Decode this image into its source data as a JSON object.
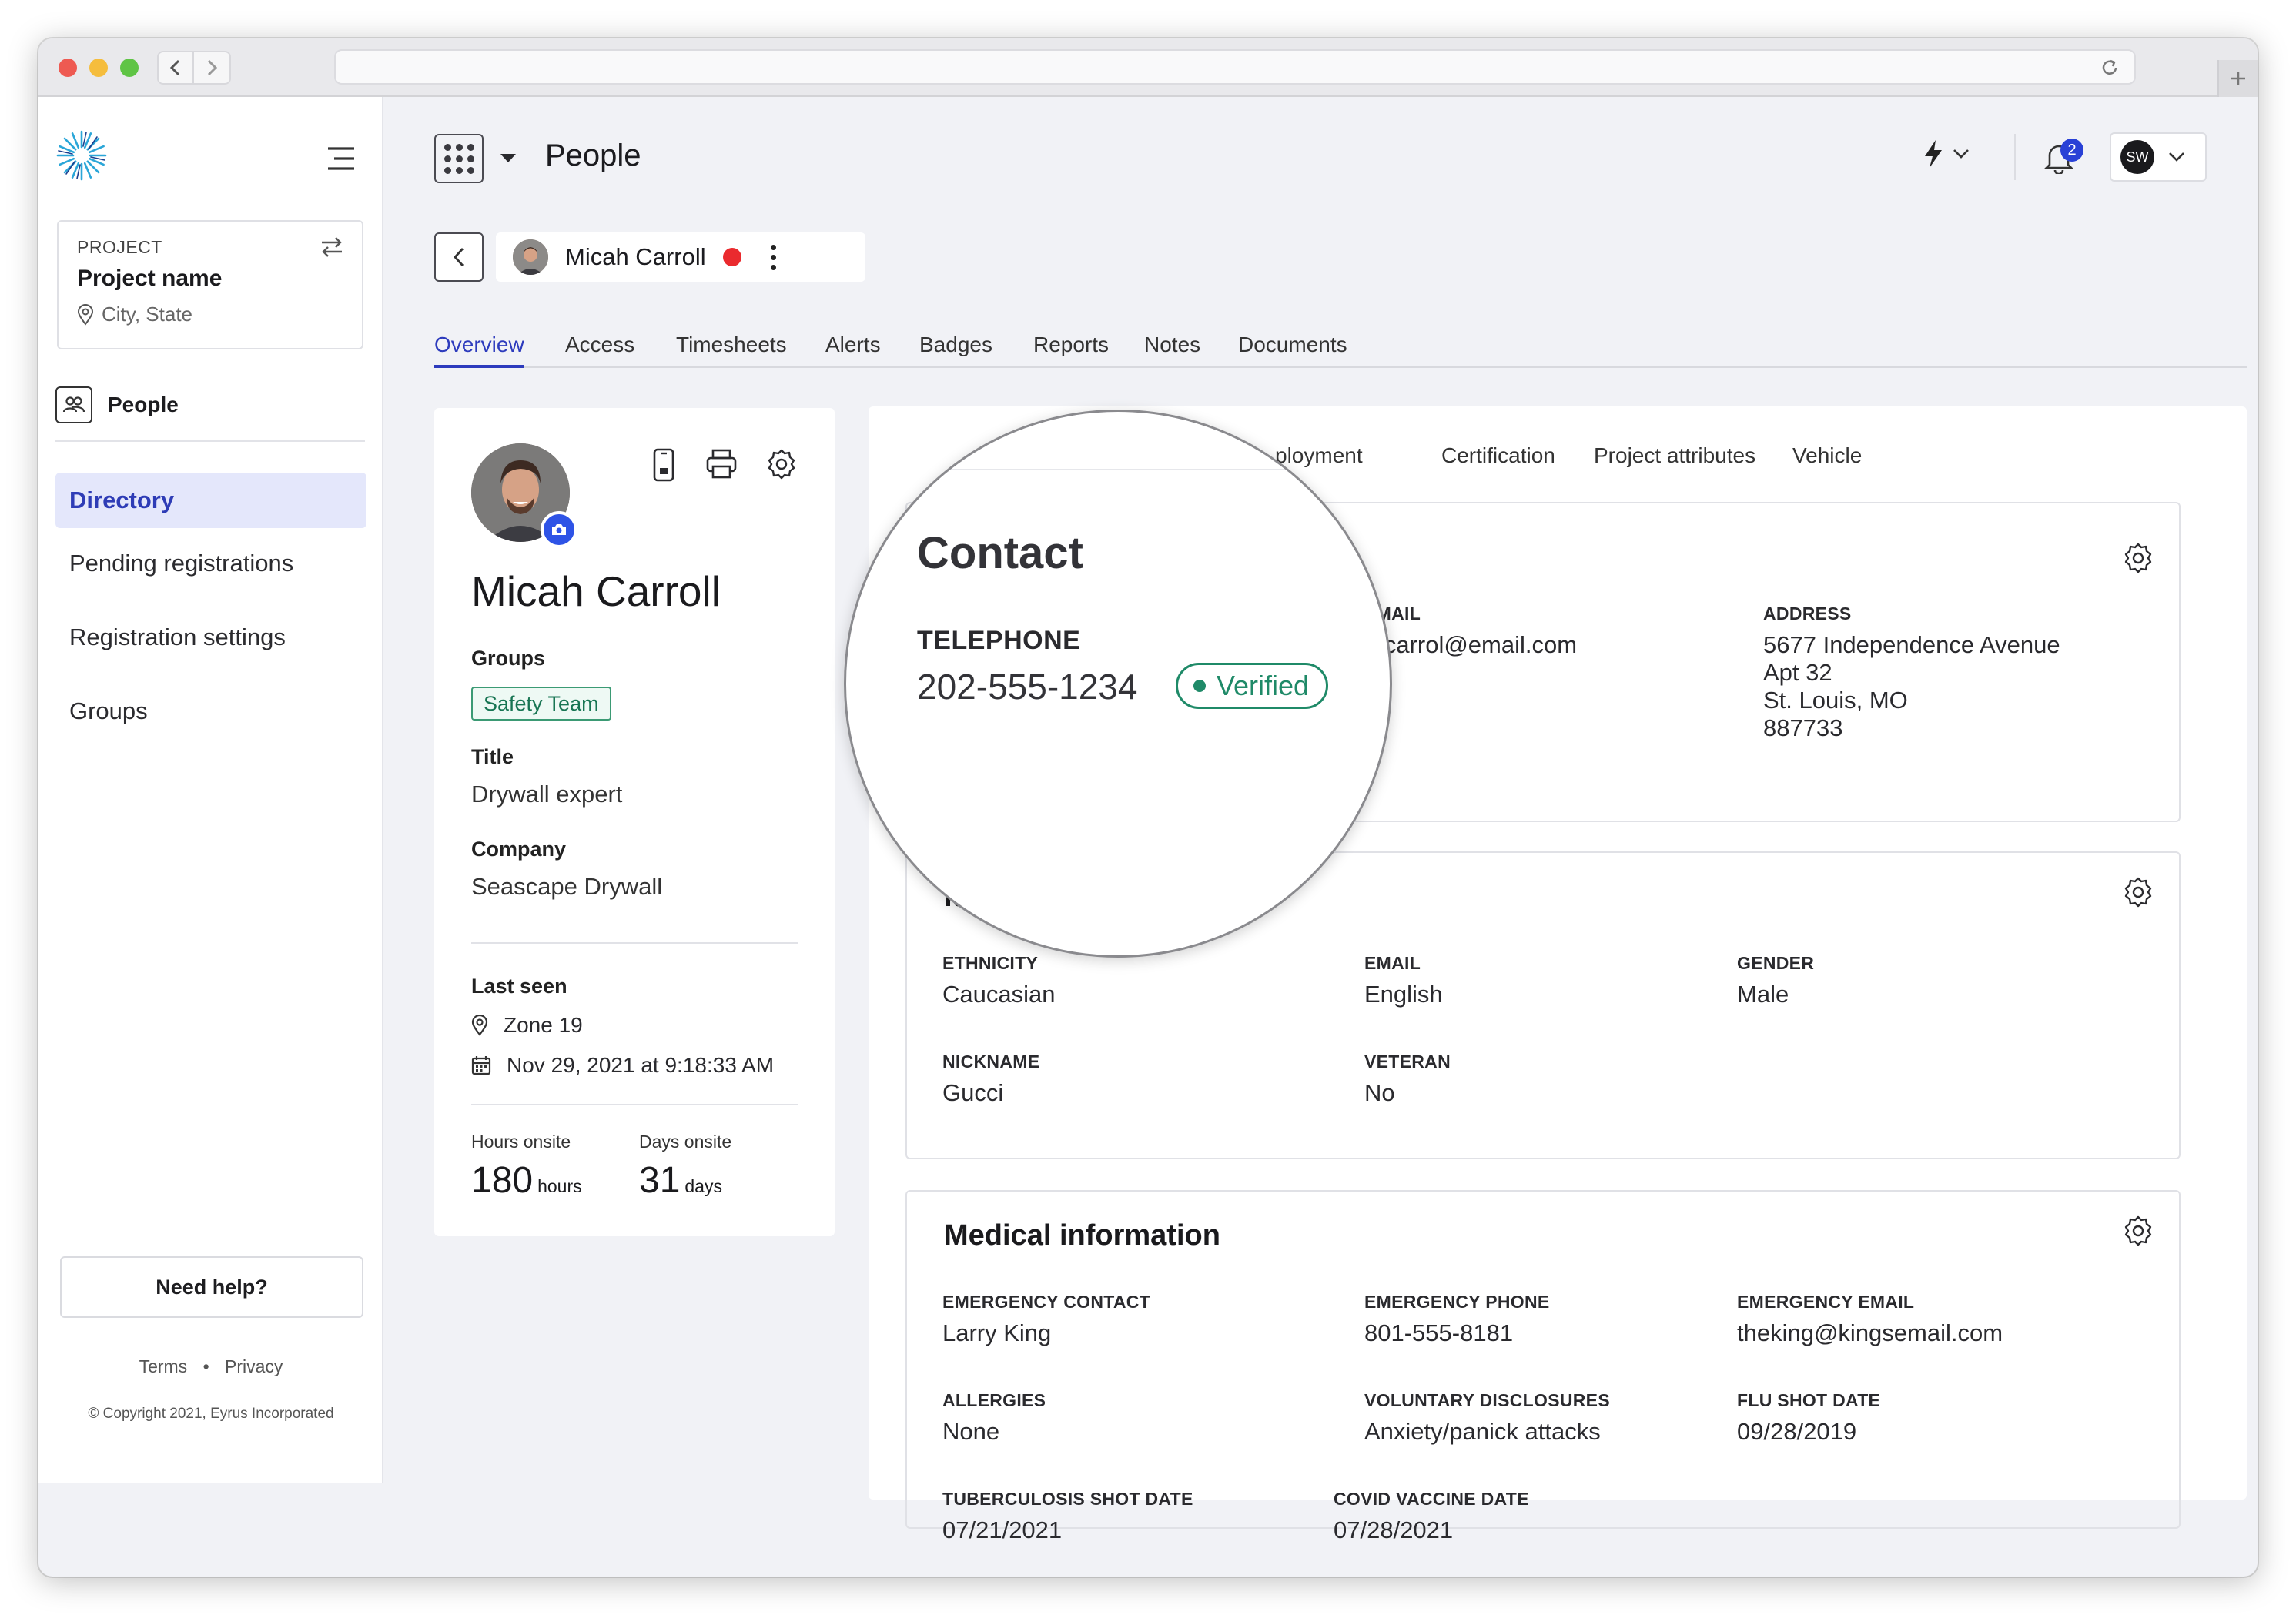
{
  "colors": {
    "accent": "#2d3bbd",
    "active_bg": "#e4e7fb",
    "status_red": "#ea2a2e",
    "verified_green": "#1f8a68",
    "badge_blue": "#2941d6"
  },
  "sidebar": {
    "project_label": "PROJECT",
    "project_name": "Project name",
    "project_location": "City, State",
    "section": "People",
    "items": [
      {
        "label": "Directory",
        "active": true
      },
      {
        "label": "Pending registrations",
        "active": false
      },
      {
        "label": "Registration settings",
        "active": false
      },
      {
        "label": "Groups",
        "active": false
      }
    ],
    "help_label": "Need help?",
    "terms": "Terms",
    "privacy": "Privacy",
    "bullet": "•",
    "copyright": "© Copyright 2021, Eyrus Incorporated"
  },
  "header": {
    "title": "People",
    "notification_count": "2",
    "user_initials": "SW"
  },
  "person": {
    "name": "Micah Carroll",
    "status_color": "#ea2a2e"
  },
  "tabs": [
    "Overview",
    "Access",
    "Timesheets",
    "Alerts",
    "Badges",
    "Reports",
    "Notes",
    "Documents"
  ],
  "profile": {
    "name": "Micah Carroll",
    "groups_label": "Groups",
    "group_tag": "Safety Team",
    "title_label": "Title",
    "title_value": "Drywall expert",
    "company_label": "Company",
    "company_value": "Seascape Drywall",
    "last_seen_label": "Last seen",
    "zone": "Zone 19",
    "last_seen_time": "Nov 29, 2021 at 9:18:33 AM",
    "hours_label": "Hours onsite",
    "hours_value": "180",
    "hours_unit": "hours",
    "days_label": "Days onsite",
    "days_value": "31",
    "days_unit": "days"
  },
  "subtabs": [
    "ployment",
    "Certification",
    "Project attributes",
    "Vehicle"
  ],
  "contact": {
    "email_label": "EMAIL",
    "email_value": "mcarrol@email.com",
    "address_label": "ADDRESS",
    "address_lines": [
      "5677 Independence Avenue",
      "Apt 32",
      "St. Louis, MO",
      "887733"
    ]
  },
  "identity": {
    "title_partial": "Ide",
    "fields": [
      {
        "label": "ETHNICITY",
        "value": "Caucasian"
      },
      {
        "label": "EMAIL",
        "value": "English"
      },
      {
        "label": "GENDER",
        "value": "Male"
      },
      {
        "label": "NICKNAME",
        "value": "Gucci"
      },
      {
        "label": "VETERAN",
        "value": "No"
      }
    ]
  },
  "medical": {
    "title": "Medical information",
    "fields": [
      {
        "label": "EMERGENCY CONTACT",
        "value": "Larry King"
      },
      {
        "label": "EMERGENCY PHONE",
        "value": "801-555-8181"
      },
      {
        "label": "EMERGENCY EMAIL",
        "value": "theking@kingsemail.com"
      },
      {
        "label": "ALLERGIES",
        "value": "None"
      },
      {
        "label": "VOLUNTARY DISCLOSURES",
        "value": "Anxiety/panick attacks"
      },
      {
        "label": "FLU SHOT DATE",
        "value": "09/28/2019"
      },
      {
        "label": "TUBERCULOSIS SHOT DATE",
        "value": "07/21/2021"
      },
      {
        "label": "COVID VACCINE DATE",
        "value": "07/28/2021"
      }
    ]
  },
  "magnifier": {
    "title": "Contact",
    "telephone_label": "TELEPHONE",
    "telephone_value": "202-555-1234",
    "verified_label": "Verified"
  }
}
